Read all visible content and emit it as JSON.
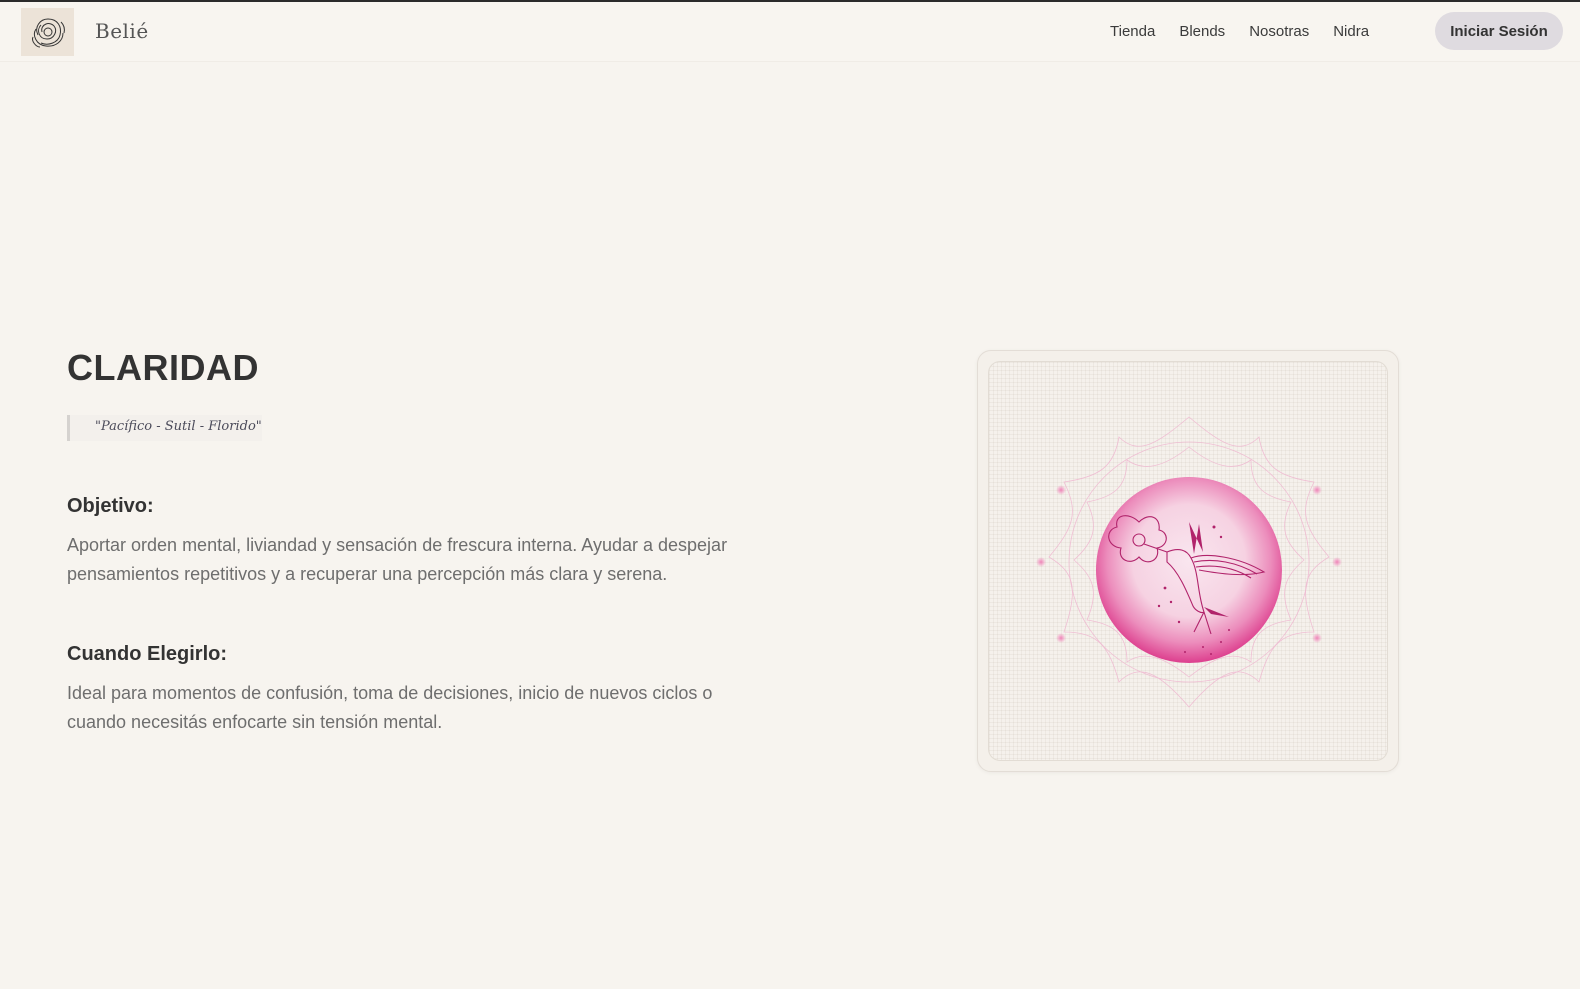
{
  "header": {
    "brand": "Belié",
    "logo_icon": "rose-logo-icon",
    "nav": [
      "Tienda",
      "Blends",
      "Nosotras",
      "Nidra"
    ],
    "login_label": "Iniciar Sesión"
  },
  "main": {
    "title": "CLARIDAD",
    "quote": "\"Pacífico - Sutil - Florido\"",
    "objective_heading": "Objetivo:",
    "objective_text": "Aportar orden mental, liviandad y sensación de frescura interna. Ayudar a despejar pensamientos repetitivos y a recuperar una percepción más clara y serena.",
    "when_heading": "Cuando Elegirlo:",
    "when_text": "Ideal para momentos de confusión, toma de decisiones, inicio de nuevos ciclos o cuando necesitás enfocarte sin tensión mental."
  },
  "card": {
    "illustration": "hummingbird-hibiscus-illustration",
    "accent_color": "#e0509a"
  }
}
